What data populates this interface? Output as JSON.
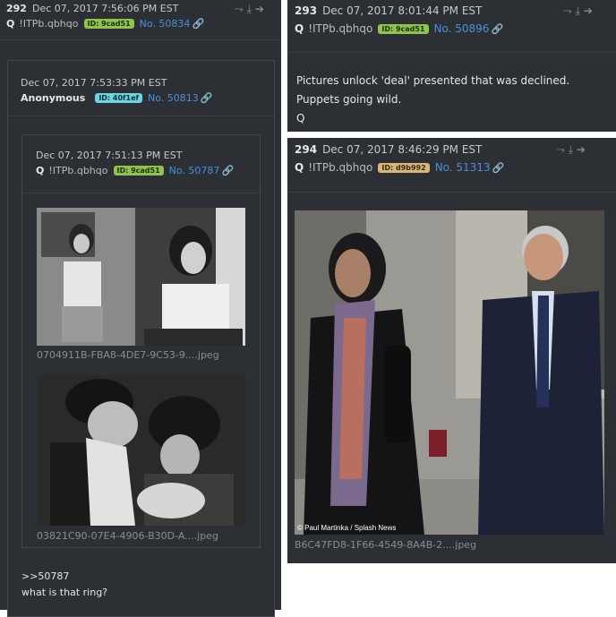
{
  "left": {
    "post_number": "292",
    "timestamp": "Dec 07, 2017 7:56:06 PM EST",
    "author": "Q",
    "tripcode": "!ITPb.qbhqo",
    "id_badge": "ID: 9cad51",
    "post_no": "No. 50834",
    "quoted": {
      "timestamp": "Dec 07, 2017 7:53:33 PM EST",
      "author": "Anonymous",
      "id_badge": "ID: 40f1ef",
      "post_no": "No. 50813",
      "nested": {
        "timestamp": "Dec 07, 2017 7:51:13 PM EST",
        "author": "Q",
        "tripcode": "!ITPb.qbhqo",
        "id_badge": "ID: 9cad51",
        "post_no": "No. 50787",
        "file1": "0704911B-FBA8-4DE7-9C53-9....jpeg",
        "file2": "03821C90-07E4-4906-B30D-A....jpeg"
      },
      "reply_ref": ">>50787",
      "reply_text": "what is that ring?"
    }
  },
  "right_top": {
    "post_number": "293",
    "timestamp": "Dec 07, 2017 8:01:44 PM EST",
    "author": "Q",
    "tripcode": "!ITPb.qbhqo",
    "id_badge": "ID: 9cad51",
    "post_no": "No. 50896",
    "lines": [
      "Pictures unlock 'deal' presented that was declined.",
      "Puppets going wild.",
      "Q"
    ]
  },
  "right_bottom": {
    "post_number": "294",
    "timestamp": "Dec 07, 2017 8:46:29 PM EST",
    "author": "Q",
    "tripcode": "!ITPb.qbhqo",
    "id_badge": "ID: d9b992",
    "post_no": "No. 51313",
    "photo_credit": "© Paul Martinka / Splash News",
    "file": "B6C47FD8-1F66-4549-8A4B-2....jpeg"
  },
  "colors": {
    "panel_bg": "#2c2f34",
    "link": "#4a90d9",
    "badge_green": "#8fc34a",
    "badge_teal": "#6cd3e0",
    "badge_tan": "#d7b77a"
  },
  "icons": [
    "share-icon",
    "download-icon",
    "goto-icon",
    "link-icon"
  ]
}
